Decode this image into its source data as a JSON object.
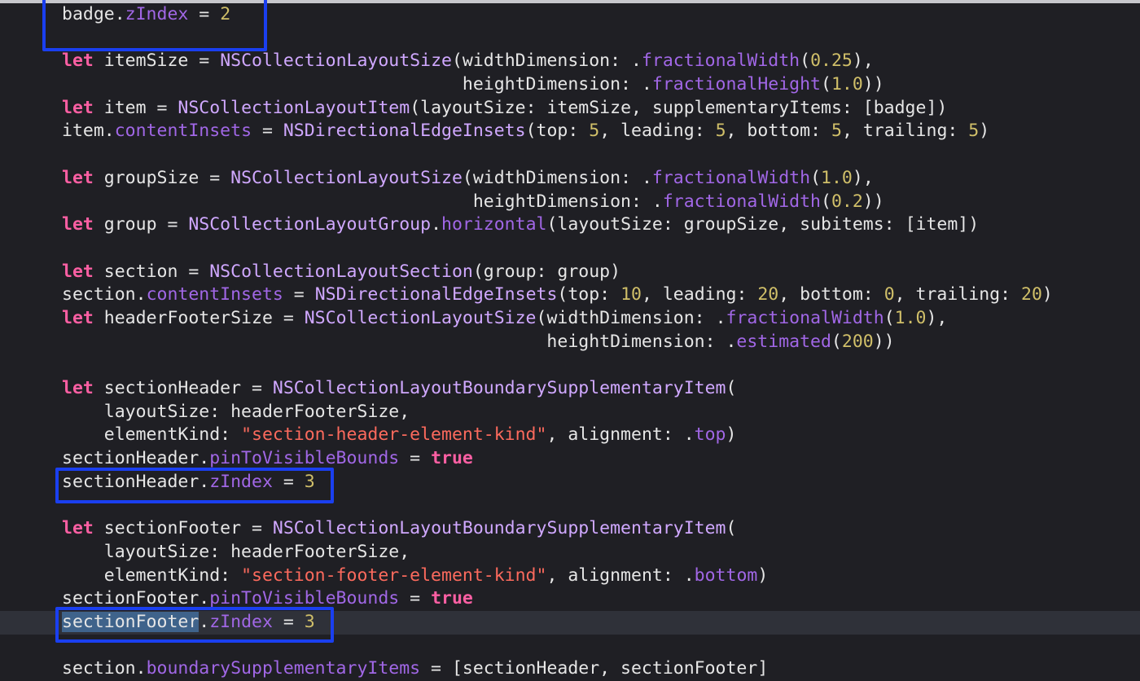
{
  "editor": {
    "colors": {
      "background": "#1f1f24",
      "keyword": "#fc5fa3",
      "number": "#d0bf69",
      "string": "#fc6a5d",
      "property": "#a167e6",
      "type": "#d0a8ff",
      "plain": "#e6e6e6",
      "highlight_box": "#1a3ff0",
      "current_line": "#2f3139",
      "selection": "#3f638b"
    },
    "current_line_index": 26,
    "lines": [
      [
        [
          "pl",
          "badge."
        ],
        [
          "prop",
          "zIndex"
        ],
        [
          "pl",
          " = "
        ],
        [
          "num",
          "2"
        ]
      ],
      [],
      [
        [
          "kw",
          "let"
        ],
        [
          "pl",
          " itemSize = "
        ],
        [
          "type",
          "NSCollectionLayoutSize"
        ],
        [
          "pl",
          "(widthDimension: ."
        ],
        [
          "prop",
          "fractionalWidth"
        ],
        [
          "pl",
          "("
        ],
        [
          "num",
          "0.25"
        ],
        [
          "pl",
          "),"
        ]
      ],
      [
        [
          "pl",
          "                                      heightDimension: ."
        ],
        [
          "prop",
          "fractionalHeight"
        ],
        [
          "pl",
          "("
        ],
        [
          "num",
          "1.0"
        ],
        [
          "pl",
          "))"
        ]
      ],
      [
        [
          "kw",
          "let"
        ],
        [
          "pl",
          " item = "
        ],
        [
          "type",
          "NSCollectionLayoutItem"
        ],
        [
          "pl",
          "(layoutSize: itemSize, supplementaryItems: [badge])"
        ]
      ],
      [
        [
          "pl",
          "item."
        ],
        [
          "prop",
          "contentInsets"
        ],
        [
          "pl",
          " = "
        ],
        [
          "type",
          "NSDirectionalEdgeInsets"
        ],
        [
          "pl",
          "(top: "
        ],
        [
          "num",
          "5"
        ],
        [
          "pl",
          ", leading: "
        ],
        [
          "num",
          "5"
        ],
        [
          "pl",
          ", bottom: "
        ],
        [
          "num",
          "5"
        ],
        [
          "pl",
          ", trailing: "
        ],
        [
          "num",
          "5"
        ],
        [
          "pl",
          ")"
        ]
      ],
      [],
      [
        [
          "kw",
          "let"
        ],
        [
          "pl",
          " groupSize = "
        ],
        [
          "type",
          "NSCollectionLayoutSize"
        ],
        [
          "pl",
          "(widthDimension: ."
        ],
        [
          "prop",
          "fractionalWidth"
        ],
        [
          "pl",
          "("
        ],
        [
          "num",
          "1.0"
        ],
        [
          "pl",
          "),"
        ]
      ],
      [
        [
          "pl",
          "                                       heightDimension: ."
        ],
        [
          "prop",
          "fractionalWidth"
        ],
        [
          "pl",
          "("
        ],
        [
          "num",
          "0.2"
        ],
        [
          "pl",
          "))"
        ]
      ],
      [
        [
          "kw",
          "let"
        ],
        [
          "pl",
          " group = "
        ],
        [
          "type",
          "NSCollectionLayoutGroup"
        ],
        [
          "pl",
          "."
        ],
        [
          "prop",
          "horizontal"
        ],
        [
          "pl",
          "(layoutSize: groupSize, subitems: [item])"
        ]
      ],
      [],
      [
        [
          "kw",
          "let"
        ],
        [
          "pl",
          " section = "
        ],
        [
          "type",
          "NSCollectionLayoutSection"
        ],
        [
          "pl",
          "(group: group)"
        ]
      ],
      [
        [
          "pl",
          "section."
        ],
        [
          "prop",
          "contentInsets"
        ],
        [
          "pl",
          " = "
        ],
        [
          "type",
          "NSDirectionalEdgeInsets"
        ],
        [
          "pl",
          "(top: "
        ],
        [
          "num",
          "10"
        ],
        [
          "pl",
          ", leading: "
        ],
        [
          "num",
          "20"
        ],
        [
          "pl",
          ", bottom: "
        ],
        [
          "num",
          "0"
        ],
        [
          "pl",
          ", trailing: "
        ],
        [
          "num",
          "20"
        ],
        [
          "pl",
          ")"
        ]
      ],
      [
        [
          "kw",
          "let"
        ],
        [
          "pl",
          " headerFooterSize = "
        ],
        [
          "type",
          "NSCollectionLayoutSize"
        ],
        [
          "pl",
          "(widthDimension: ."
        ],
        [
          "prop",
          "fractionalWidth"
        ],
        [
          "pl",
          "("
        ],
        [
          "num",
          "1.0"
        ],
        [
          "pl",
          "),"
        ]
      ],
      [
        [
          "pl",
          "                                              heightDimension: ."
        ],
        [
          "prop",
          "estimated"
        ],
        [
          "pl",
          "("
        ],
        [
          "num",
          "200"
        ],
        [
          "pl",
          "))"
        ]
      ],
      [],
      [
        [
          "kw",
          "let"
        ],
        [
          "pl",
          " sectionHeader = "
        ],
        [
          "type",
          "NSCollectionLayoutBoundarySupplementaryItem"
        ],
        [
          "pl",
          "("
        ]
      ],
      [
        [
          "pl",
          "    layoutSize: headerFooterSize,"
        ]
      ],
      [
        [
          "pl",
          "    elementKind: "
        ],
        [
          "str",
          "\"section-header-element-kind\""
        ],
        [
          "pl",
          ", alignment: ."
        ],
        [
          "prop",
          "top"
        ],
        [
          "pl",
          ")"
        ]
      ],
      [
        [
          "pl",
          "sectionHeader."
        ],
        [
          "prop",
          "pinToVisibleBounds"
        ],
        [
          "pl",
          " = "
        ],
        [
          "kw",
          "true"
        ]
      ],
      [
        [
          "pl",
          "sectionHeader."
        ],
        [
          "prop",
          "zIndex"
        ],
        [
          "pl",
          " = "
        ],
        [
          "num",
          "3"
        ]
      ],
      [],
      [
        [
          "kw",
          "let"
        ],
        [
          "pl",
          " sectionFooter = "
        ],
        [
          "type",
          "NSCollectionLayoutBoundarySupplementaryItem"
        ],
        [
          "pl",
          "("
        ]
      ],
      [
        [
          "pl",
          "    layoutSize: headerFooterSize,"
        ]
      ],
      [
        [
          "pl",
          "    elementKind: "
        ],
        [
          "str",
          "\"section-footer-element-kind\""
        ],
        [
          "pl",
          ", alignment: ."
        ],
        [
          "prop",
          "bottom"
        ],
        [
          "pl",
          ")"
        ]
      ],
      [
        [
          "pl",
          "sectionFooter."
        ],
        [
          "prop",
          "pinToVisibleBounds"
        ],
        [
          "pl",
          " = "
        ],
        [
          "kw",
          "true"
        ]
      ],
      [
        [
          "sel",
          "sectionFooter"
        ],
        [
          "pl",
          "."
        ],
        [
          "prop",
          "zIndex"
        ],
        [
          "pl",
          " = "
        ],
        [
          "num",
          "3"
        ]
      ],
      [],
      [
        [
          "pl",
          "section."
        ],
        [
          "prop",
          "boundarySupplementaryItems"
        ],
        [
          "pl",
          " = [sectionHeader, sectionFooter]"
        ]
      ]
    ]
  }
}
